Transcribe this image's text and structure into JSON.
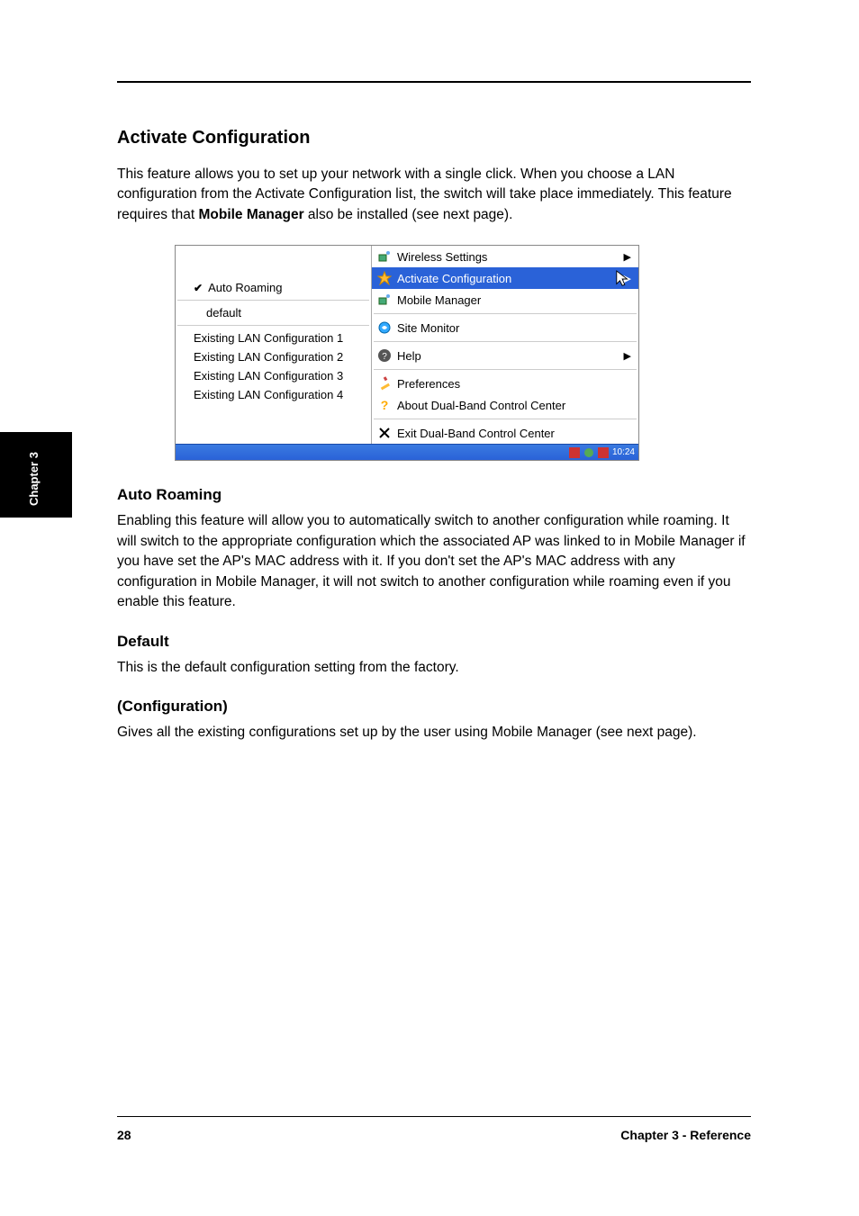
{
  "header": {
    "section_title": "Activate Configuration",
    "intro": "This feature allows you to set up your network with a single click. When you choose a LAN configuration from the Activate Configuration list, the switch will take place immediately. This feature requires that ",
    "intro_bold": "Mobile Manager",
    "intro_tail": " also be installed (see next page)."
  },
  "screenshot": {
    "submenu": {
      "auto_roaming": "Auto Roaming",
      "default": "default",
      "configs": [
        "Existing LAN Configuration 1",
        "Existing LAN Configuration 2",
        "Existing LAN Configuration 3",
        "Existing LAN Configuration 4"
      ]
    },
    "main_menu": [
      {
        "icon": "wireless-icon",
        "label": "Wireless Settings",
        "arrow": true
      },
      {
        "icon": "activate-icon",
        "label": "Activate Configuration",
        "arrow": true,
        "selected": true
      },
      {
        "icon": "mobile-icon",
        "label": "Mobile Manager"
      },
      {
        "sep": true
      },
      {
        "icon": "monitor-icon",
        "label": "Site Monitor"
      },
      {
        "sep": true
      },
      {
        "icon": "help-icon",
        "label": "Help",
        "arrow": true
      },
      {
        "sep": true
      },
      {
        "icon": "pref-icon",
        "label": "Preferences"
      },
      {
        "icon": "about-icon",
        "label": "About Dual-Band Control Center"
      },
      {
        "sep": true
      },
      {
        "icon": "exit-icon",
        "label": "Exit Dual-Band Control Center"
      }
    ],
    "time": "10:24"
  },
  "sections": [
    {
      "title": "Auto Roaming",
      "body": "Enabling this feature will allow you to automatically switch to another configuration while roaming. It will switch to the appropriate configuration which the associated AP was linked to in Mobile Manager if you have set the AP's MAC address with it. If you don't set the AP's MAC address with any configuration in Mobile Manager, it will not switch to another configuration while roaming even if you enable this feature."
    },
    {
      "title": "Default",
      "body": "This is the default configuration setting from the factory."
    },
    {
      "title": "(Configuration)",
      "body": "Gives all the existing configurations set up by the user using Mobile Manager (see next page)."
    }
  ],
  "sidebar_tab": "Chapter 3",
  "footer": {
    "page": "28",
    "text": "Chapter 3 - Reference"
  }
}
